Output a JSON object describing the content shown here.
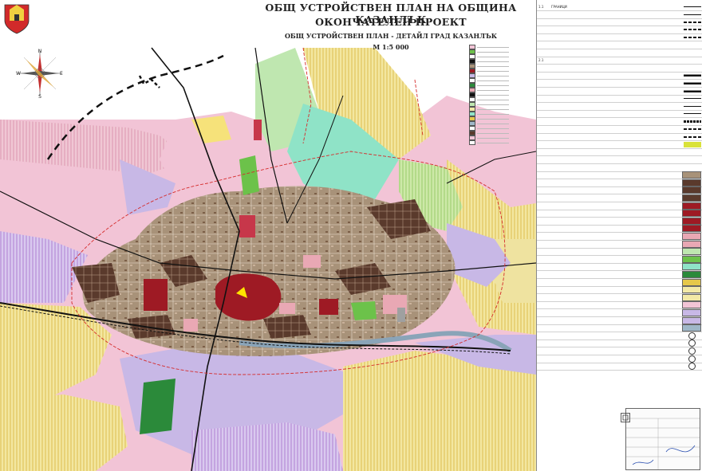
{
  "title": {
    "line1": "ОБЩ УСТРОЙСТВЕН ПЛАН НА ОБЩИНА КАЗАНЛЪК",
    "line2": "ОКОНЧАТЕЛЕН ПРОЕКТ",
    "line3": "ОБЩ УСТРОЙСТВЕН ПЛАН - ДЕТАЙЛ ГРАД КАЗАНЛЪК",
    "scale": "М 1:5 000"
  },
  "compass": {
    "north": "N",
    "south": "S",
    "east": "E",
    "west": "W"
  },
  "colors": {
    "residential_brown": "#a89279",
    "residential_dark": "#5a3a2c",
    "center_red": "#9e1a24",
    "mixed_pink": "#e9a8b4",
    "industrial_lilac": "#c8b8e6",
    "agri_yellow": "#f3e9a6",
    "agri_pink": "#f2c4d6",
    "green_park": "#6cc24a",
    "green_light": "#bfe7b0",
    "mint": "#8fe3c7",
    "orchard": "#e6c84a",
    "forest": "#2b8a3a",
    "river": "#9fb7c8",
    "road": "#111111"
  },
  "legend": {
    "rows": [
      {
        "num": "1.1",
        "text": "ГРАНИЦИ",
        "sym": "line"
      },
      {
        "num": "",
        "text": "",
        "sym": "line"
      },
      {
        "num": "",
        "text": "",
        "sym": "dash"
      },
      {
        "num": "",
        "text": "",
        "sym": "dash"
      },
      {
        "num": "",
        "text": "",
        "sym": "dash"
      },
      {
        "num": "",
        "text": "",
        "sym": "none"
      },
      {
        "num": "",
        "text": "",
        "sym": "none"
      },
      {
        "num": "2.1",
        "text": "",
        "sym": "none"
      },
      {
        "num": "",
        "text": "",
        "sym": "none"
      },
      {
        "num": "",
        "text": "",
        "sym": "thick"
      },
      {
        "num": "",
        "text": "",
        "sym": "thick"
      },
      {
        "num": "",
        "text": "",
        "sym": "thick"
      },
      {
        "num": "",
        "text": "",
        "sym": "line"
      },
      {
        "num": "",
        "text": "",
        "sym": "line"
      },
      {
        "num": "",
        "text": "",
        "sym": "line"
      },
      {
        "num": "",
        "text": "",
        "sym": "rail"
      },
      {
        "num": "",
        "text": "",
        "sym": "dash"
      },
      {
        "num": "",
        "text": "",
        "sym": "dash"
      },
      {
        "num": "",
        "text": "",
        "sym": "yellow"
      },
      {
        "num": "",
        "text": "",
        "sym": "none"
      },
      {
        "num": "",
        "text": "",
        "sym": "none"
      },
      {
        "num": "",
        "text": "",
        "sym": "none"
      },
      {
        "num": "",
        "text": "",
        "sym": "residential_brown"
      },
      {
        "num": "",
        "text": "",
        "sym": "residential_dark"
      },
      {
        "num": "",
        "text": "",
        "sym": "residential_dark"
      },
      {
        "num": "",
        "text": "",
        "sym": "residential_dark"
      },
      {
        "num": "",
        "text": "",
        "sym": "center_red"
      },
      {
        "num": "",
        "text": "",
        "sym": "center_red"
      },
      {
        "num": "",
        "text": "",
        "sym": "center_red"
      },
      {
        "num": "",
        "text": "",
        "sym": "center_red"
      },
      {
        "num": "",
        "text": "",
        "sym": "mixed_pink"
      },
      {
        "num": "",
        "text": "",
        "sym": "mixed_pink"
      },
      {
        "num": "",
        "text": "",
        "sym": "green_light"
      },
      {
        "num": "",
        "text": "",
        "sym": "green_park"
      },
      {
        "num": "",
        "text": "",
        "sym": "mint"
      },
      {
        "num": "",
        "text": "",
        "sym": "forest"
      },
      {
        "num": "",
        "text": "",
        "sym": "orchard"
      },
      {
        "num": "",
        "text": "",
        "sym": "agri_yellow"
      },
      {
        "num": "",
        "text": "",
        "sym": "agri_yellow"
      },
      {
        "num": "",
        "text": "",
        "sym": "agri_pink"
      },
      {
        "num": "",
        "text": "",
        "sym": "industrial_lilac"
      },
      {
        "num": "",
        "text": "",
        "sym": "industrial_lilac"
      },
      {
        "num": "",
        "text": "",
        "sym": "river"
      },
      {
        "num": "",
        "text": "",
        "sym": "circle"
      },
      {
        "num": "",
        "text": "",
        "sym": "circle"
      },
      {
        "num": "",
        "text": "",
        "sym": "circle"
      },
      {
        "num": "",
        "text": "",
        "sym": "circle"
      },
      {
        "num": "",
        "text": "",
        "sym": "circle"
      }
    ]
  }
}
